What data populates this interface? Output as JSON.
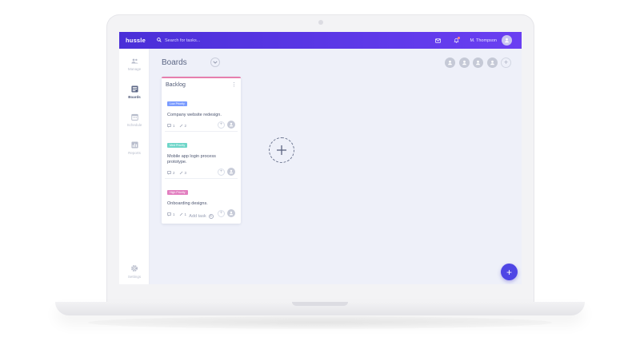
{
  "app": {
    "brand": "hussle"
  },
  "topbar": {
    "search_placeholder": "Search for tasks...",
    "user_name": "M. Thompson",
    "icons": [
      "search-icon",
      "mail-icon",
      "bell-icon",
      "user-icon"
    ],
    "accent": "#5b35ea"
  },
  "sidebar": {
    "items": [
      {
        "label": "Manage",
        "icon": "people-icon",
        "active": false
      },
      {
        "label": "Boards",
        "icon": "boards-icon",
        "active": true
      },
      {
        "label": "Schedule",
        "icon": "calendar-icon",
        "active": false
      },
      {
        "label": "Reports",
        "icon": "chart-icon",
        "active": false
      },
      {
        "label": "Settings",
        "icon": "gear-icon",
        "active": false
      }
    ]
  },
  "main": {
    "title": "Boards",
    "members_count": 4,
    "column": {
      "title": "Backlog",
      "accent": "#e67fae",
      "cards": [
        {
          "tag": "Low Priority",
          "tag_color": "#7b9cff",
          "title": "Company website redesign.",
          "comments": "1",
          "attachments": "2"
        },
        {
          "tag": "Med Priority",
          "tag_color": "#6fd6c9",
          "title": "Mobile app login process prototype.",
          "comments": "2",
          "attachments": "3"
        },
        {
          "tag": "High Priority",
          "tag_color": "#e27fc0",
          "title": "Onboarding designs.",
          "comments": "1",
          "attachments": "1"
        }
      ],
      "add_task_label": "Add task"
    }
  },
  "fab": {
    "label": "+"
  }
}
